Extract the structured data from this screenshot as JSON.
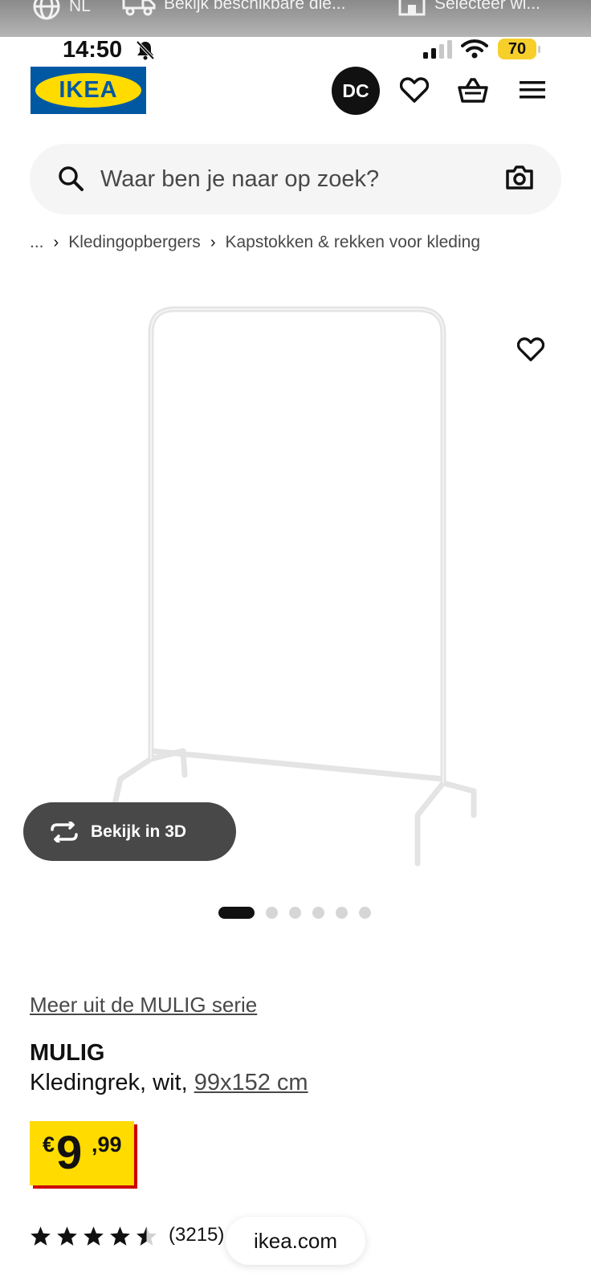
{
  "top_strip": {
    "items": [
      {
        "label": "NL",
        "icon": "globe-icon"
      },
      {
        "label": "Bekijk beschikbare die...",
        "icon": "truck-icon"
      },
      {
        "label": "Selecteer wi...",
        "icon": "store-icon"
      }
    ]
  },
  "status_bar": {
    "time": "14:50",
    "battery": "70",
    "icons": [
      "bell-off-icon",
      "signal-icon",
      "wifi-icon",
      "battery-icon"
    ]
  },
  "header": {
    "logo_text": "IKEA",
    "avatar_initials": "DC",
    "colors": {
      "brand_blue": "#0058a3",
      "brand_yellow": "#ffdb00"
    }
  },
  "search": {
    "placeholder": "Waar ben je naar op zoek?"
  },
  "breadcrumb": {
    "items": [
      "...",
      "Kledingopbergers",
      "Kapstokken & rekken voor kleding"
    ]
  },
  "gallery": {
    "view_3d_label": "Bekijk in 3D",
    "image_count": 6,
    "active_index": 0
  },
  "product": {
    "series_link": "Meer uit de MULIG serie",
    "name": "MULIG",
    "description": "Kledingrek, wit, ",
    "dimensions": "99x152 cm",
    "price": {
      "currency": "€",
      "integer": "9",
      "decimals": ",99"
    },
    "rating": {
      "stars": 4.5,
      "max": 5,
      "count": "(3215)"
    }
  },
  "browser": {
    "domain": "ikea.com"
  }
}
